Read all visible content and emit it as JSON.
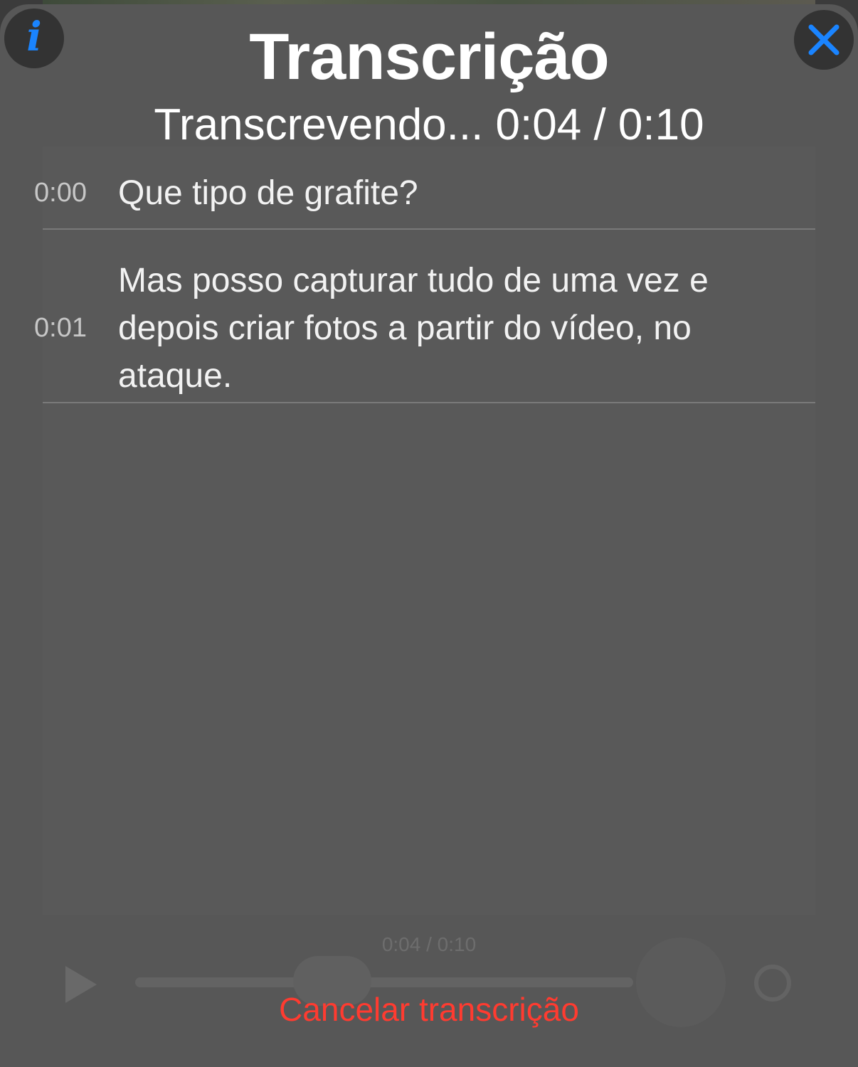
{
  "header": {
    "title": "Transcrição",
    "status": "Transcrevendo... 0:04 / 0:10",
    "info_icon": "info-icon",
    "close_icon": "close-icon",
    "accent_color": "#1a84ff"
  },
  "transcript": [
    {
      "time": "0:00",
      "text": "Que tipo de grafite?"
    },
    {
      "time": "0:01",
      "text": "Mas posso capturar tudo de uma vez e depois criar fotos a partir do vídeo, no ataque."
    }
  ],
  "background_player": {
    "time": "0:04 / 0:10"
  },
  "footer": {
    "cancel_label": "Cancelar transcrição",
    "cancel_color": "#ff3b30"
  }
}
